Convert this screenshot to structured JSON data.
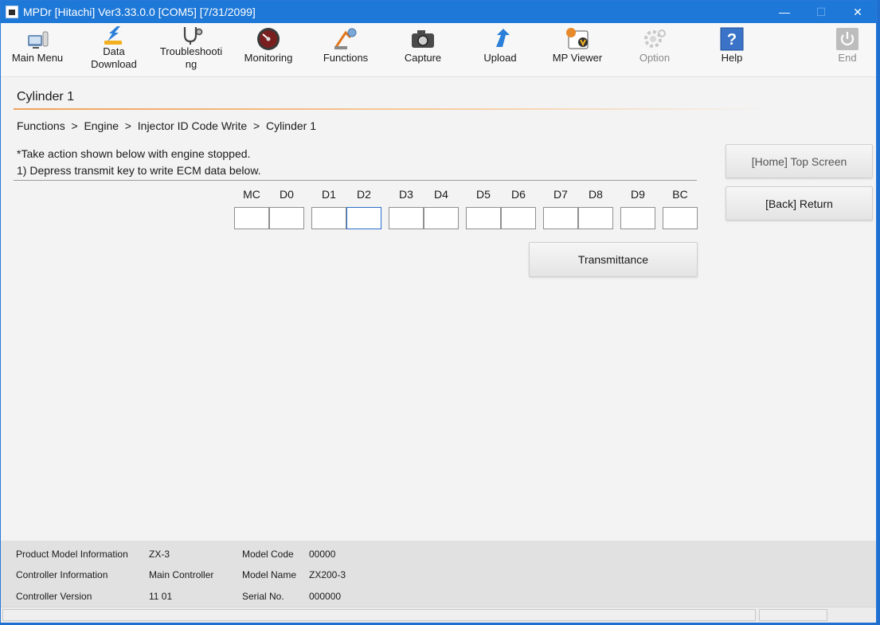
{
  "window": {
    "title": "MPDr [Hitachi]  Ver3.33.0.0 [COM5] [7/31/2099]",
    "minimize_glyph": "—",
    "maximize_glyph": "☐",
    "close_glyph": "✕"
  },
  "toolbar": {
    "main_menu": "Main Menu",
    "data_download_1": "Data",
    "data_download_2": "Download",
    "troubleshooting_1": "Troubleshooti",
    "troubleshooting_2": "ng",
    "monitoring": "Monitoring",
    "functions": "Functions",
    "capture": "Capture",
    "upload": "Upload",
    "mp_viewer": "MP Viewer",
    "option": "Option",
    "help": "Help",
    "end": "End"
  },
  "page": {
    "title": "Cylinder 1",
    "breadcrumb": [
      "Functions",
      "  >  ",
      "Engine",
      "  >  ",
      "Injector ID Code Write",
      "  >  ",
      "Cylinder 1"
    ],
    "instruction_1": "*Take action shown below with engine stopped.",
    "instruction_2": "1) Depress transmit key to write ECM data below."
  },
  "code_fields": {
    "headers": [
      "MC",
      "D0",
      "D1",
      "D2",
      "D3",
      "D4",
      "D5",
      "D6",
      "D7",
      "D8",
      "D9",
      "BC"
    ],
    "values": [
      "",
      "",
      "",
      "",
      "",
      "",
      "",
      "",
      "",
      "",
      "",
      ""
    ]
  },
  "buttons": {
    "home": "[Home] Top Screen",
    "back": "[Back] Return",
    "transmit": "Transmittance"
  },
  "footer": {
    "product_model_label": "Product Model Information",
    "product_model_value": "ZX-3",
    "controller_info_label": "Controller Information",
    "controller_info_value": "Main Controller",
    "controller_version_label": "Controller Version",
    "controller_version_value": "11 01",
    "model_code_label": "Model Code",
    "model_code_value": "00000",
    "model_name_label": "Model Name",
    "model_name_value": "ZX200-3",
    "serial_label": "Serial No.",
    "serial_value": "000000"
  },
  "colors": {
    "titlebar": "#1e78d7",
    "accent_rule": "#f0a15a",
    "focus_border": "#2a6fc9"
  }
}
